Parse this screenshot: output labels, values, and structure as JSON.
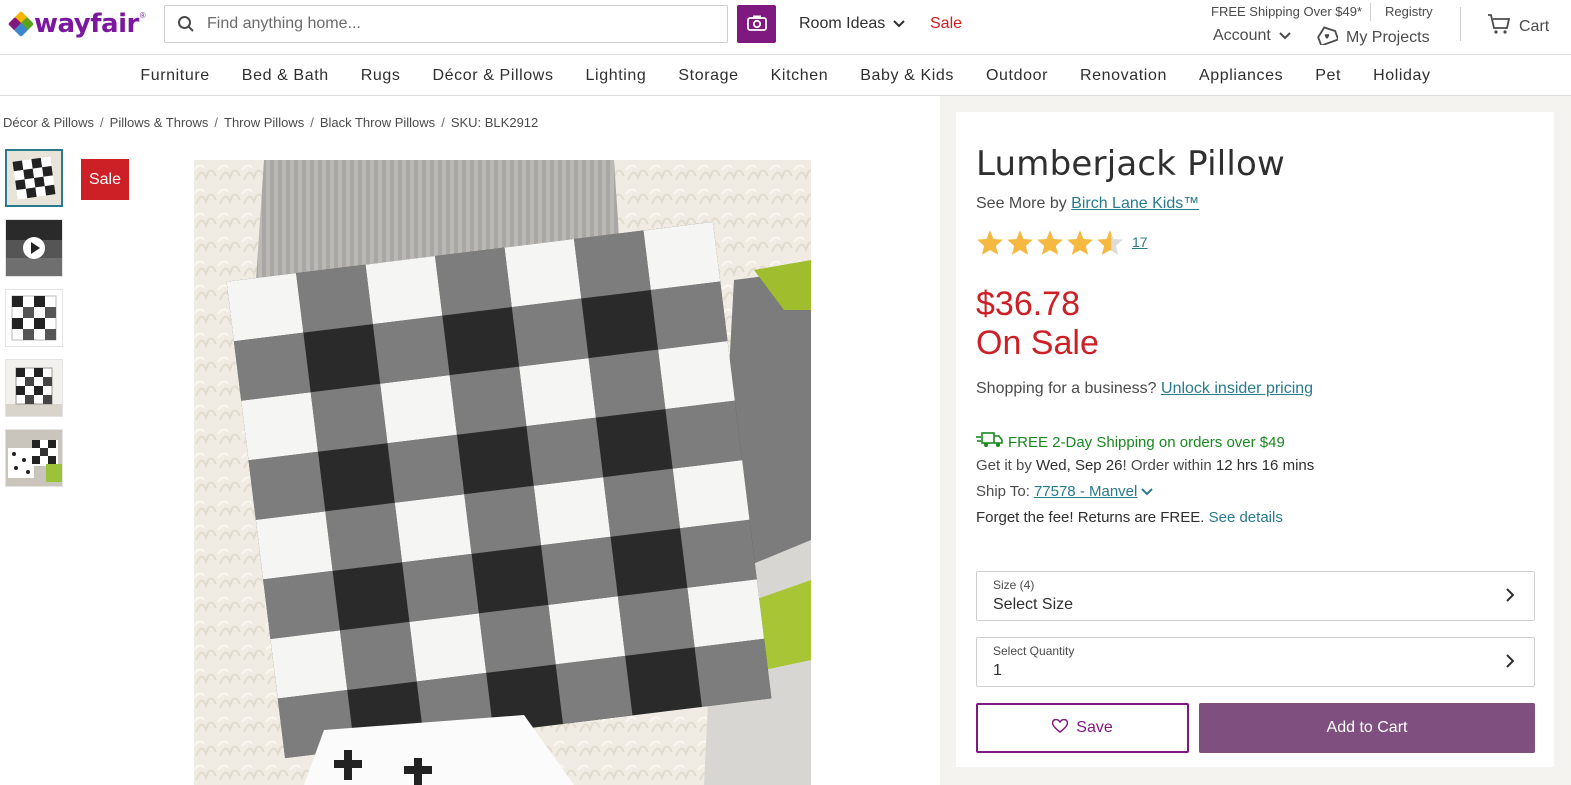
{
  "header": {
    "logo_text": "wayfair",
    "search_placeholder": "Find anything home...",
    "room_ideas": "Room Ideas",
    "sale": "Sale",
    "free_shipping": "FREE Shipping Over $49*",
    "registry": "Registry",
    "account": "Account",
    "my_projects": "My Projects",
    "cart": "Cart"
  },
  "categories": [
    "Furniture",
    "Bed & Bath",
    "Rugs",
    "Décor & Pillows",
    "Lighting",
    "Storage",
    "Kitchen",
    "Baby & Kids",
    "Outdoor",
    "Renovation",
    "Appliances",
    "Pet",
    "Holiday"
  ],
  "breadcrumb": [
    "Décor & Pillows",
    "Pillows & Throws",
    "Throw Pillows",
    "Black Throw Pillows",
    "SKU: BLK2912"
  ],
  "gallery": {
    "sale_badge": "Sale"
  },
  "product": {
    "title": "Lumberjack Pillow",
    "see_more_prefix": "See More by ",
    "brand": "Birch Lane Kids™",
    "rating": 4.5,
    "review_count": "17",
    "price": "$36.78",
    "on_sale": "On Sale",
    "business_text": "Shopping for a business? ",
    "business_link": "Unlock insider pricing",
    "shipping": "FREE 2-Day Shipping on orders over $49",
    "get_it_prefix": "Get it by ",
    "get_it_date": "Wed, Sep 26",
    "order_within_prefix": "! Order within ",
    "order_within": "12 hrs 16 mins",
    "ship_to_label": "Ship To: ",
    "ship_to_value": "77578 - Manvel",
    "returns_text": "Forget the fee! Returns are FREE. ",
    "returns_link": "See details",
    "size_label": "Size (4)",
    "size_value": "Select Size",
    "quantity_label": "Select Quantity",
    "quantity_value": "1",
    "save_label": "Save",
    "add_to_cart_label": "Add to Cart"
  },
  "colors": {
    "brand_purple": "#7f187f",
    "sale_red": "#cd2026",
    "link_teal": "#297a8c",
    "shipping_green": "#19891f",
    "star_gold": "#f5b942"
  }
}
